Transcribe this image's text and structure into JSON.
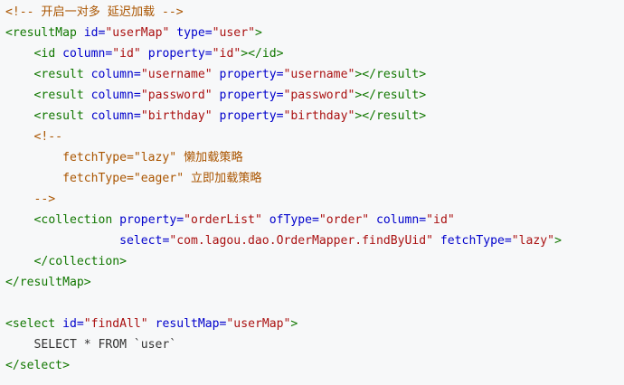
{
  "code_lines": [
    [
      {
        "t": "<!-- 开启一对多 延迟加载 -->",
        "c": "cmt"
      }
    ],
    [
      {
        "t": "<resultMap",
        "c": "tag"
      },
      {
        "t": " ",
        "c": "txt"
      },
      {
        "t": "id=",
        "c": "attr"
      },
      {
        "t": "\"userMap\"",
        "c": "str"
      },
      {
        "t": " ",
        "c": "txt"
      },
      {
        "t": "type=",
        "c": "attr"
      },
      {
        "t": "\"user\"",
        "c": "str"
      },
      {
        "t": ">",
        "c": "tag"
      }
    ],
    [
      {
        "t": "    ",
        "c": "txt"
      },
      {
        "t": "<id",
        "c": "tag"
      },
      {
        "t": " ",
        "c": "txt"
      },
      {
        "t": "column=",
        "c": "attr"
      },
      {
        "t": "\"id\"",
        "c": "str"
      },
      {
        "t": " ",
        "c": "txt"
      },
      {
        "t": "property=",
        "c": "attr"
      },
      {
        "t": "\"id\"",
        "c": "str"
      },
      {
        "t": "></id>",
        "c": "tag"
      }
    ],
    [
      {
        "t": "    ",
        "c": "txt"
      },
      {
        "t": "<result",
        "c": "tag"
      },
      {
        "t": " ",
        "c": "txt"
      },
      {
        "t": "column=",
        "c": "attr"
      },
      {
        "t": "\"username\"",
        "c": "str"
      },
      {
        "t": " ",
        "c": "txt"
      },
      {
        "t": "property=",
        "c": "attr"
      },
      {
        "t": "\"username\"",
        "c": "str"
      },
      {
        "t": "></result>",
        "c": "tag"
      }
    ],
    [
      {
        "t": "    ",
        "c": "txt"
      },
      {
        "t": "<result",
        "c": "tag"
      },
      {
        "t": " ",
        "c": "txt"
      },
      {
        "t": "column=",
        "c": "attr"
      },
      {
        "t": "\"password\"",
        "c": "str"
      },
      {
        "t": " ",
        "c": "txt"
      },
      {
        "t": "property=",
        "c": "attr"
      },
      {
        "t": "\"password\"",
        "c": "str"
      },
      {
        "t": "></result>",
        "c": "tag"
      }
    ],
    [
      {
        "t": "    ",
        "c": "txt"
      },
      {
        "t": "<result",
        "c": "tag"
      },
      {
        "t": " ",
        "c": "txt"
      },
      {
        "t": "column=",
        "c": "attr"
      },
      {
        "t": "\"birthday\"",
        "c": "str"
      },
      {
        "t": " ",
        "c": "txt"
      },
      {
        "t": "property=",
        "c": "attr"
      },
      {
        "t": "\"birthday\"",
        "c": "str"
      },
      {
        "t": "></result>",
        "c": "tag"
      }
    ],
    [
      {
        "t": "    <!--",
        "c": "cmt"
      }
    ],
    [
      {
        "t": "        fetchType=\"lazy\" 懒加载策略",
        "c": "cmt"
      }
    ],
    [
      {
        "t": "        fetchType=\"eager\" 立即加载策略",
        "c": "cmt"
      }
    ],
    [
      {
        "t": "    -->",
        "c": "cmt"
      }
    ],
    [
      {
        "t": "    ",
        "c": "txt"
      },
      {
        "t": "<collection",
        "c": "tag"
      },
      {
        "t": " ",
        "c": "txt"
      },
      {
        "t": "property=",
        "c": "attr"
      },
      {
        "t": "\"orderList\"",
        "c": "str"
      },
      {
        "t": " ",
        "c": "txt"
      },
      {
        "t": "ofType=",
        "c": "attr"
      },
      {
        "t": "\"order\"",
        "c": "str"
      },
      {
        "t": " ",
        "c": "txt"
      },
      {
        "t": "column=",
        "c": "attr"
      },
      {
        "t": "\"id\"",
        "c": "str"
      }
    ],
    [
      {
        "t": "                ",
        "c": "txt"
      },
      {
        "t": "select=",
        "c": "attr"
      },
      {
        "t": "\"com.lagou.dao.OrderMapper.findByUid\"",
        "c": "str"
      },
      {
        "t": " ",
        "c": "txt"
      },
      {
        "t": "fetchType=",
        "c": "attr"
      },
      {
        "t": "\"lazy\"",
        "c": "str"
      },
      {
        "t": ">",
        "c": "tag"
      }
    ],
    [
      {
        "t": "    ",
        "c": "txt"
      },
      {
        "t": "</collection>",
        "c": "tag"
      }
    ],
    [
      {
        "t": "</resultMap>",
        "c": "tag"
      }
    ],
    [
      {
        "t": "",
        "c": "txt"
      }
    ],
    [
      {
        "t": "<select",
        "c": "tag"
      },
      {
        "t": " ",
        "c": "txt"
      },
      {
        "t": "id=",
        "c": "attr"
      },
      {
        "t": "\"findAll\"",
        "c": "str"
      },
      {
        "t": " ",
        "c": "txt"
      },
      {
        "t": "resultMap=",
        "c": "attr"
      },
      {
        "t": "\"userMap\"",
        "c": "str"
      },
      {
        "t": ">",
        "c": "tag"
      }
    ],
    [
      {
        "t": "    SELECT * FROM `user`",
        "c": "txt"
      }
    ],
    [
      {
        "t": "</select>",
        "c": "tag"
      }
    ]
  ],
  "colors": {
    "background": "#f7f8f9",
    "tag": "#117700",
    "attribute": "#0000cc",
    "string": "#aa1111",
    "comment": "#aa5500",
    "text": "#333333"
  }
}
